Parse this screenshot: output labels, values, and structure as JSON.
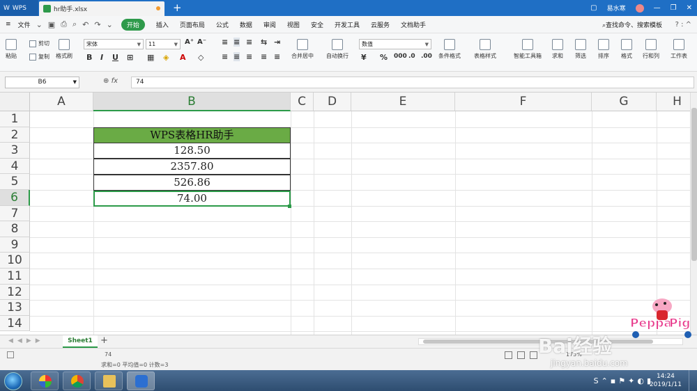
{
  "titlebar": {
    "app_tab": "WPS",
    "file_tab": "hr助手.xlsx",
    "new_tab": "+",
    "user_name": "易水寒"
  },
  "menubar": {
    "file": "文件",
    "items": [
      "开始",
      "插入",
      "页面布局",
      "公式",
      "数据",
      "审阅",
      "视图",
      "安全",
      "开发工具",
      "云服务",
      "文档助手"
    ],
    "search": "查找命令、搜索模板"
  },
  "ribbon": {
    "paste": "粘贴",
    "cut": "剪切",
    "copy": "复制",
    "format_painter": "格式刷",
    "font_name": "宋体",
    "font_size": "11",
    "merge_center": "合并居中",
    "wrap_text": "自动换行",
    "number_format": "数值",
    "percent": "%",
    "conditional_format": "条件格式",
    "table_style": "表格样式",
    "smart_toolbox": "智能工具箱",
    "sum": "求和",
    "filter": "筛选",
    "sort": "排序",
    "format": "格式",
    "row_col": "行和列",
    "worksheet": "工作表"
  },
  "formula_bar": {
    "name_box": "B6",
    "fx": "fx",
    "value": "74"
  },
  "columns": [
    "A",
    "B",
    "C",
    "D",
    "E",
    "F",
    "G",
    "H"
  ],
  "rows": [
    "1",
    "2",
    "3",
    "4",
    "5",
    "6",
    "7",
    "8",
    "9",
    "10",
    "11",
    "12",
    "13",
    "14"
  ],
  "table": {
    "header": "WPS表格HR助手",
    "values": [
      "128.50",
      "2357.80",
      "526.86",
      "74.00"
    ]
  },
  "sheets": {
    "active": "Sheet1"
  },
  "status": {
    "value": "74",
    "summary": "求和=0  平均值=0  计数=3",
    "zoom": "175%"
  },
  "taskbar": {
    "time": "14:24",
    "date": "2019/1/11"
  },
  "watermark": {
    "brand": "Bai经验",
    "url": "jingyan.baidu.com"
  },
  "colors": {
    "accent": "#2b9a48",
    "header_fill": "#6aab45",
    "titlebar": "#1f6fc5"
  }
}
